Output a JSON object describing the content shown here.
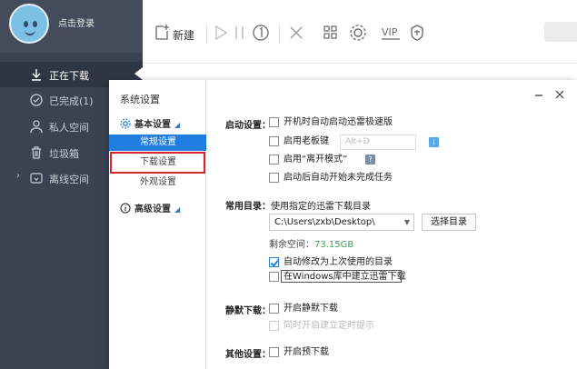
{
  "sidebar": {
    "login_label": "点击登录",
    "items": [
      {
        "label": "正在下载",
        "icon": "download-icon"
      },
      {
        "label": "已完成(1)",
        "icon": "check-circle-icon"
      },
      {
        "label": "私人空间",
        "icon": "person-icon"
      },
      {
        "label": "垃圾箱",
        "icon": "trash-icon"
      },
      {
        "label": "离线空间",
        "icon": "offline-cloud-icon"
      }
    ]
  },
  "toolbar": {
    "new_label": "新建",
    "vip_label": "VIP"
  },
  "dialog": {
    "title": "系统设置",
    "nav": {
      "basic_group": "基本设置",
      "items": [
        "常规设置",
        "下载设置",
        "外观设置"
      ],
      "advanced_group": "高级设置"
    },
    "startup": {
      "label": "启动设置：",
      "opt_autostart": "开机时自动启动迅雷极速版",
      "opt_bosskey": "启用老板键",
      "hotkey_placeholder": "Alt+D",
      "opt_leave_mode": "启用“离开模式”",
      "opt_resume": "启动后自动开始未完成任务"
    },
    "directory": {
      "label": "常用目录：",
      "desc": "使用指定的迅雷下载目录",
      "path": "C:\\Users\\zxb\\Desktop\\",
      "browse_button": "选择目录",
      "free_label": "剩余空间：",
      "free_value": "73.15GB",
      "opt_auto_modify": "自动修改为上次使用的目录",
      "opt_windows_lib": "在Windows库中建立迅雷下载"
    },
    "silent": {
      "label": "静默下载：",
      "opt_enable": "开启静默下载",
      "opt_disabled_hint": "同时开启建立定时提示"
    },
    "other": {
      "label": "其他设置：",
      "opt_preload": "开启预下载"
    }
  },
  "colors": {
    "sidebar_bg": "#3b4352",
    "accent_blue": "#1f7ee0",
    "highlight_red": "#d8262e",
    "free_space_green": "#3aa655"
  }
}
